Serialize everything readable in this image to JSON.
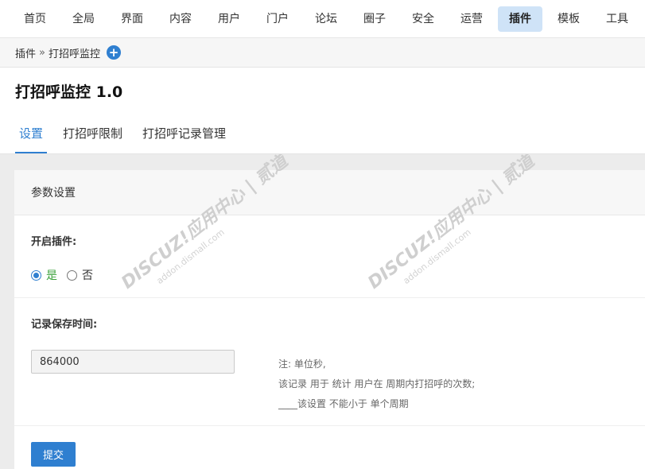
{
  "topnav": {
    "items": [
      {
        "label": "首页",
        "active": false
      },
      {
        "label": "全局",
        "active": false
      },
      {
        "label": "界面",
        "active": false
      },
      {
        "label": "内容",
        "active": false
      },
      {
        "label": "用户",
        "active": false
      },
      {
        "label": "门户",
        "active": false
      },
      {
        "label": "论坛",
        "active": false
      },
      {
        "label": "圈子",
        "active": false
      },
      {
        "label": "安全",
        "active": false
      },
      {
        "label": "运营",
        "active": false
      },
      {
        "label": "插件",
        "active": true
      },
      {
        "label": "模板",
        "active": false
      },
      {
        "label": "工具",
        "active": false
      }
    ]
  },
  "breadcrumb": {
    "parent": "插件",
    "separator": "»",
    "current": "打招呼监控"
  },
  "page": {
    "title": "打招呼监控 1.0"
  },
  "tabs": [
    {
      "label": "设置",
      "active": true
    },
    {
      "label": "打招呼限制",
      "active": false
    },
    {
      "label": "打招呼记录管理",
      "active": false
    }
  ],
  "panel": {
    "heading": "参数设置",
    "enable_plugin": {
      "label": "开启插件:",
      "option_yes": "是",
      "option_no": "否",
      "selected": "是"
    },
    "record_time": {
      "label": "记录保存时间:",
      "value": "864000",
      "hint_line1": "注: 单位秒,",
      "hint_line2": "该记录 用于 统计 用户在 周期内打招呼的次数;",
      "hint_line3": "____该设置 不能小于 单个周期"
    },
    "submit_label": "提交"
  },
  "watermark": {
    "text": "DISCUZ!应用中心 | 贰道",
    "subtext": "addon.dismall.com",
    "color": "#c8c8c8"
  },
  "colors": {
    "accent": "#2f7fd0",
    "active_nav_bg": "#cfe3f7",
    "yes_green": "#3aa13a"
  }
}
